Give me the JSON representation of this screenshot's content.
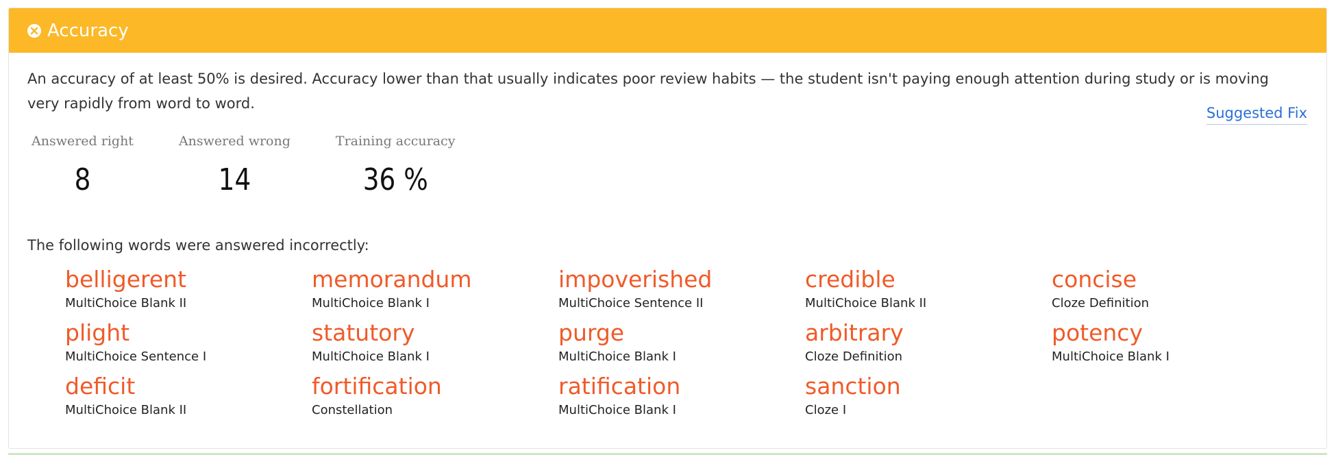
{
  "header": {
    "icon": "close-circle-icon",
    "title": "Accuracy",
    "color": "#fcb827"
  },
  "description": "An accuracy of at least 50% is desired. Accuracy lower than that usually indicates poor review habits — the student isn't paying enough attention during study or is moving very rapidly from word to word.",
  "suggested_fix_label": "Suggested Fix",
  "stats": [
    {
      "label": "Answered right",
      "value": "8"
    },
    {
      "label": "Answered wrong",
      "value": "14"
    },
    {
      "label": "Training accuracy",
      "value": "36 %"
    }
  ],
  "words_intro": "The following words were answered incorrectly:",
  "words": [
    {
      "word": "belligerent",
      "type": "MultiChoice Blank II"
    },
    {
      "word": "memorandum",
      "type": "MultiChoice Blank I"
    },
    {
      "word": "impoverished",
      "type": "MultiChoice Sentence II"
    },
    {
      "word": "credible",
      "type": "MultiChoice Blank II"
    },
    {
      "word": "concise",
      "type": "Cloze Definition"
    },
    {
      "word": "plight",
      "type": "MultiChoice Sentence I"
    },
    {
      "word": "statutory",
      "type": "MultiChoice Blank I"
    },
    {
      "word": "purge",
      "type": "MultiChoice Blank I"
    },
    {
      "word": "arbitrary",
      "type": "Cloze Definition"
    },
    {
      "word": "potency",
      "type": "MultiChoice Blank I"
    },
    {
      "word": "deficit",
      "type": "MultiChoice Blank II"
    },
    {
      "word": "fortification",
      "type": "Constellation"
    },
    {
      "word": "ratification",
      "type": "MultiChoice Blank I"
    },
    {
      "word": "sanction",
      "type": "Cloze I"
    }
  ],
  "colors": {
    "word": "#f05a28",
    "link": "#2a6fd6"
  }
}
